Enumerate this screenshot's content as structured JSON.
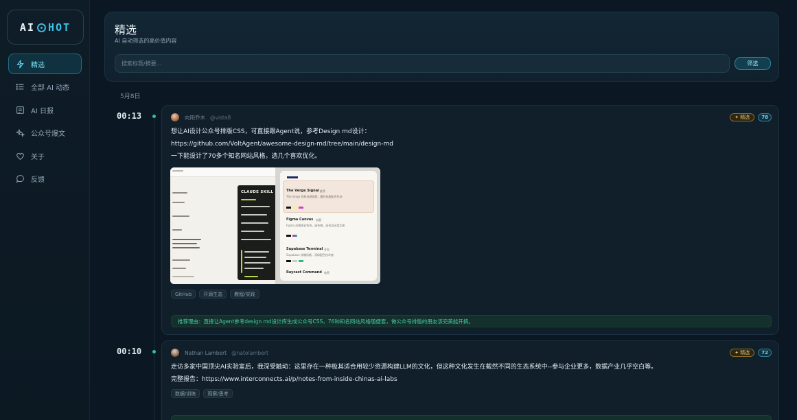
{
  "logo": {
    "left": "AI",
    "right": "HOT"
  },
  "sidebar": {
    "items": [
      {
        "label": "精选",
        "icon": "lightning-icon",
        "active": true
      },
      {
        "label": "全部 AI 动态",
        "icon": "list-icon",
        "active": false
      },
      {
        "label": "AI 日报",
        "icon": "newspaper-icon",
        "active": false
      },
      {
        "label": "公众号爆文",
        "icon": "sparkle-icon",
        "active": false
      },
      {
        "label": "关于",
        "icon": "heart-icon",
        "active": false
      },
      {
        "label": "反馈",
        "icon": "chat-bubble-icon",
        "active": false
      }
    ]
  },
  "header": {
    "title": "精选",
    "subtitle": "AI 自动筛选的高价值内容",
    "search_placeholder": "搜索标题/摘要...",
    "filter_label": "筛选"
  },
  "date_label": "5月8日",
  "posts": [
    {
      "time": "00:13",
      "author": "向阳乔木",
      "handle": "@vista8",
      "badge": "✦ 精选",
      "score": "78",
      "lines": [
        "想让AI设计公众号排版CSS，可直接跟Agent说，参考Design md设计：",
        "https://github.com/VoltAgent/awesome-design-md/tree/main/design-md",
        "一下能设计了70多个知名网站风格，选几个喜欢优化。"
      ],
      "preview": {
        "left_title": "CLAUDE SKILL",
        "right_items": [
          {
            "name": "The Verge Signal",
            "tag": "推荐",
            "desc": "The Verge 的科技感排版，醒目标题配合色块"
          },
          {
            "name": "Figma Canvas",
            "tag": "创意",
            "desc": "Figma 风格多彩色块，画布感，适合设计类文章"
          },
          {
            "name": "Supabase Terminal",
            "tag": "开发",
            "desc": "Supabase 终端风格，深绿配色技术感"
          },
          {
            "name": "Raycast Command",
            "tag": "效率",
            "desc": ""
          }
        ]
      },
      "tags": [
        "GitHub",
        "开源生态",
        "教程/实践"
      ],
      "recommendation": "推荐理由：直接让Agent参考design md设计库生成公众号CSS，76种知名网站风格随便套，做公众号排版的朋友该完美能开搞。"
    },
    {
      "time": "00:10",
      "author": "Nathan Lambert",
      "handle": "@natolambert",
      "badge": "✦ 精选",
      "score": "72",
      "lines": [
        "走访多家中国顶尖AI实验室后，我深受触动：这里存在一种极其适合用较少资源构建LLM的文化，但这种文化发生在截然不同的生态系统中--参与企业更多，数据产业几乎空白等。",
        "完整报告：https://www.interconnects.ai/p/notes-from-inside-chinas-ai-labs"
      ],
      "tags": [
        "数据/训练",
        "观察/思考"
      ]
    }
  ]
}
